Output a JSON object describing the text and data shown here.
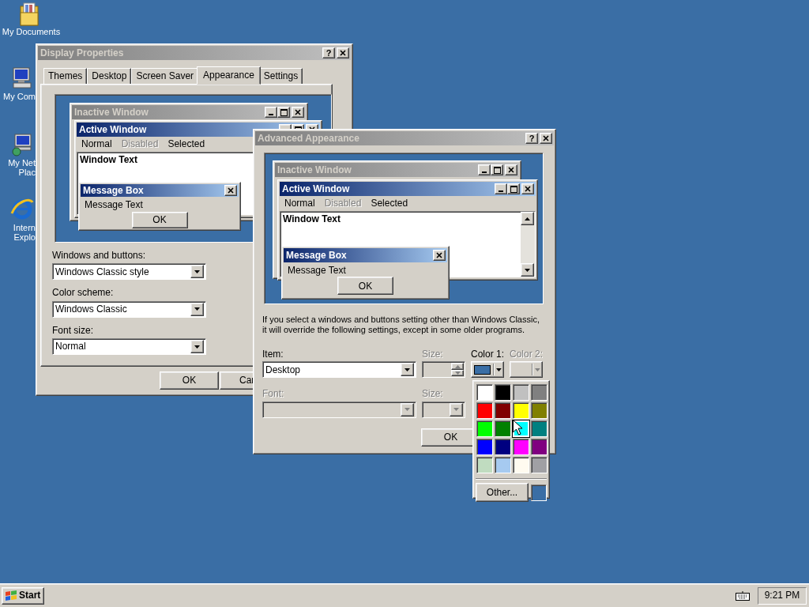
{
  "desktop_icons": [
    {
      "kind": "folder",
      "lines": [
        "My Documents"
      ]
    },
    {
      "kind": "computer",
      "lines": [
        "My Com"
      ]
    },
    {
      "kind": "network",
      "lines": [
        "My Net",
        "Plac"
      ]
    },
    {
      "kind": "browser",
      "lines": [
        "Intern",
        "Explo"
      ]
    }
  ],
  "display_properties": {
    "title": "Display Properties",
    "active": false,
    "caption_buttons": [
      {
        "kind": "help",
        "label": "?"
      },
      {
        "kind": "close"
      }
    ],
    "tabs": [
      {
        "label": "Themes",
        "selected": false
      },
      {
        "label": "Desktop",
        "selected": false
      },
      {
        "label": "Screen Saver",
        "selected": false
      },
      {
        "label": "Appearance",
        "selected": true
      },
      {
        "label": "Settings",
        "selected": false
      }
    ],
    "preview": {
      "windows": [
        {
          "title": "Inactive Window",
          "active": false,
          "caption_buttons": [
            {
              "kind": "minimize"
            },
            {
              "kind": "maximize"
            },
            {
              "kind": "close"
            }
          ]
        },
        {
          "title": "Active Window",
          "active": true,
          "caption_buttons": [
            {
              "kind": "minimize"
            },
            {
              "kind": "maximize"
            },
            {
              "kind": "close"
            }
          ],
          "menu": [
            {
              "label": "Normal",
              "disabled": false
            },
            {
              "label": "Disabled",
              "disabled": true
            },
            {
              "label": "Selected",
              "disabled": false
            }
          ],
          "window_text": "Window Text"
        }
      ],
      "message_box": {
        "title": "Message Box",
        "active": true,
        "text": "Message Text",
        "button": "OK"
      }
    },
    "fields": [
      {
        "label": "Windows and buttons:",
        "value": "Windows Classic style"
      },
      {
        "label": "Color scheme:",
        "value": "Windows Classic"
      },
      {
        "label": "Font size:",
        "value": "Normal"
      }
    ],
    "buttons": [
      "OK",
      "Car"
    ]
  },
  "advanced_appearance": {
    "title": "Advanced Appearance",
    "active": false,
    "caption_buttons": [
      {
        "kind": "help",
        "label": "?"
      },
      {
        "kind": "close"
      }
    ],
    "preview": {
      "windows": [
        {
          "title": "Inactive Window",
          "active": false,
          "caption_buttons": [
            {
              "kind": "minimize"
            },
            {
              "kind": "maximize"
            },
            {
              "kind": "close"
            }
          ]
        },
        {
          "title": "Active Window",
          "active": true,
          "caption_buttons": [
            {
              "kind": "minimize"
            },
            {
              "kind": "maximize"
            },
            {
              "kind": "close"
            }
          ],
          "menu": [
            {
              "label": "Normal",
              "disabled": false
            },
            {
              "label": "Disabled",
              "disabled": true
            },
            {
              "label": "Selected",
              "disabled": false
            }
          ],
          "window_text": "Window Text",
          "scrollbar": true
        }
      ],
      "message_box": {
        "title": "Message Box",
        "active": true,
        "text": "Message Text",
        "button": "OK"
      }
    },
    "note": "If you select a windows and buttons setting other than Windows Classic, it will override the following settings, except in some older programs.",
    "item": {
      "label": "Item:",
      "value": "Desktop",
      "disabled": false
    },
    "item_size": {
      "label": "Size:",
      "disabled": true
    },
    "color1": {
      "label": "Color 1:",
      "color": "#3a6ea5",
      "disabled": false
    },
    "color2": {
      "label": "Color 2:",
      "disabled": true
    },
    "font": {
      "label": "Font:",
      "disabled": true
    },
    "font_size": {
      "label": "Size:",
      "disabled": true
    },
    "buttons": [
      "OK"
    ]
  },
  "color_popup": {
    "swatches": [
      {
        "color": "#ffffff",
        "selected": false
      },
      {
        "color": "#000000",
        "selected": false
      },
      {
        "color": "#c0c0c0",
        "selected": false
      },
      {
        "color": "#808080",
        "selected": false
      },
      {
        "color": "#ff0000",
        "selected": false
      },
      {
        "color": "#800000",
        "selected": false
      },
      {
        "color": "#ffff00",
        "selected": false
      },
      {
        "color": "#808000",
        "selected": false
      },
      {
        "color": "#00ff00",
        "selected": false
      },
      {
        "color": "#008000",
        "selected": false
      },
      {
        "color": "#00ffff",
        "selected": true
      },
      {
        "color": "#008080",
        "selected": false
      },
      {
        "color": "#0000ff",
        "selected": false
      },
      {
        "color": "#000080",
        "selected": false
      },
      {
        "color": "#ff00ff",
        "selected": false
      },
      {
        "color": "#800080",
        "selected": false
      },
      {
        "color": "#c0dcc0",
        "selected": false
      },
      {
        "color": "#a6caf0",
        "selected": false
      },
      {
        "color": "#fffbf0",
        "selected": false
      },
      {
        "color": "#a0a0a4",
        "selected": false
      }
    ],
    "other_button": "Other...",
    "custom_swatch": {
      "color": "#3a6ea5"
    }
  },
  "taskbar": {
    "start": "Start",
    "clock": "9:21 PM"
  }
}
